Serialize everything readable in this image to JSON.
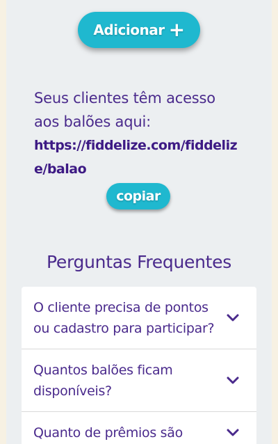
{
  "add_button": {
    "label": "Adicionar",
    "icon": "plus-icon",
    "color": "#1fb8cf"
  },
  "share": {
    "text": "Seus clientes têm acesso aos balões aqui:",
    "link": "https://fiddelize.com/fiddelize/balao",
    "copy_label": "copiar"
  },
  "faq": {
    "title": "Perguntas Frequentes",
    "items": [
      {
        "question": "O cliente precisa de pontos ou cadastro para participar?",
        "icon": "chevron-down-icon"
      },
      {
        "question": "Quantos balões ficam disponíveis?",
        "icon": "chevron-down-icon"
      },
      {
        "question": "Quanto de prêmios são",
        "icon": "chevron-down-icon"
      }
    ]
  },
  "colors": {
    "accent": "#1fb8cf",
    "text_purple": "#4a2a8c",
    "page_bg": "#f7f1e3",
    "panel_bg": "#eceff1"
  }
}
